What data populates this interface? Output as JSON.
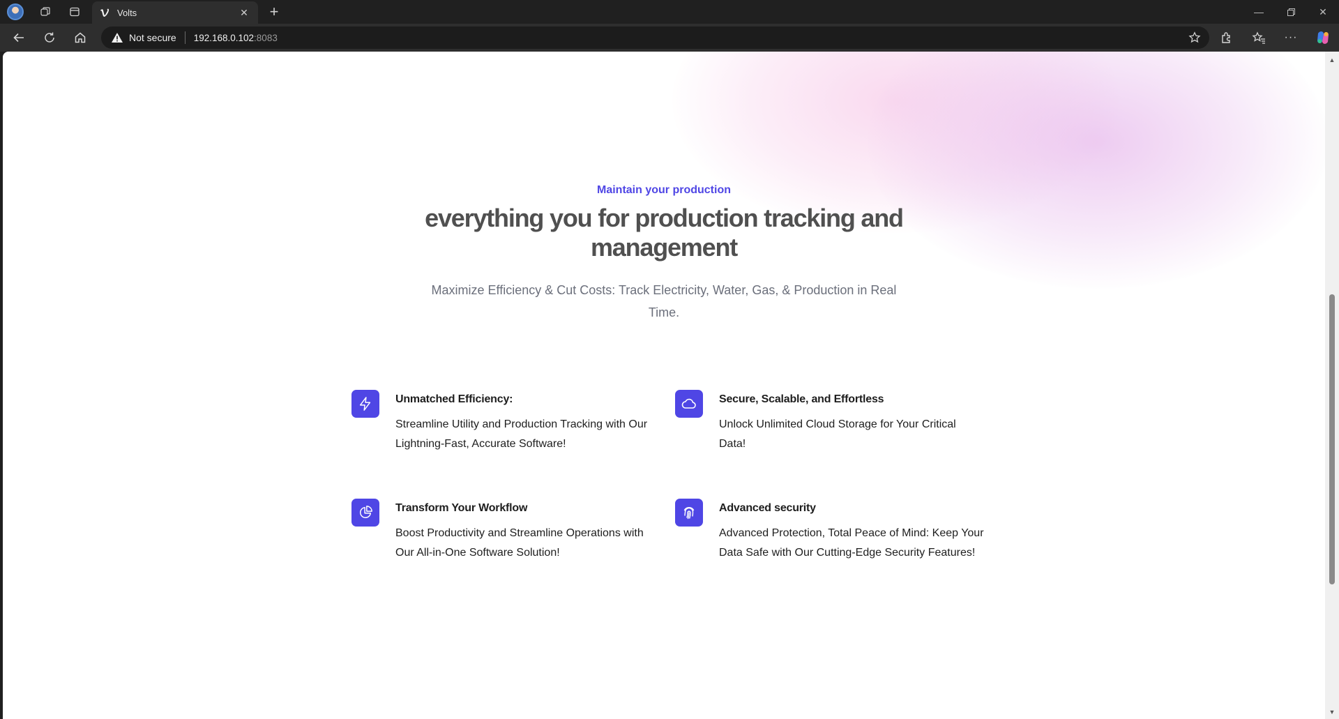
{
  "browser": {
    "tab_title": "Volts",
    "security_label": "Not secure",
    "url_host": "192.168.0.102",
    "url_port": ":8083"
  },
  "hero": {
    "eyebrow": "Maintain your production",
    "headline": "everything you for production tracking and management",
    "subtitle": "Maximize Efficiency & Cut Costs: Track Electricity, Water, Gas, & Production in Real Time."
  },
  "features": [
    {
      "icon": "lightning-icon",
      "title": "Unmatched Efficiency:",
      "text": "Streamline Utility and Production Tracking with Our Lightning-Fast, Accurate Software!"
    },
    {
      "icon": "cloud-icon",
      "title": "Secure, Scalable, and Effortless",
      "text": "Unlock Unlimited Cloud Storage for Your Critical Data!"
    },
    {
      "icon": "pie-chart-icon",
      "title": "Transform Your Workflow",
      "text": "Boost Productivity and Streamline Operations with Our All-in-One Software Solution!"
    },
    {
      "icon": "fingerprint-icon",
      "title": "Advanced security",
      "text": "Advanced Protection, Total Peace of Mind: Keep Your Data Safe with Our Cutting-Edge Security Features!"
    }
  ],
  "colors": {
    "accent": "#4f46e5",
    "heading": "#505050",
    "body": "#1e1e1e"
  }
}
